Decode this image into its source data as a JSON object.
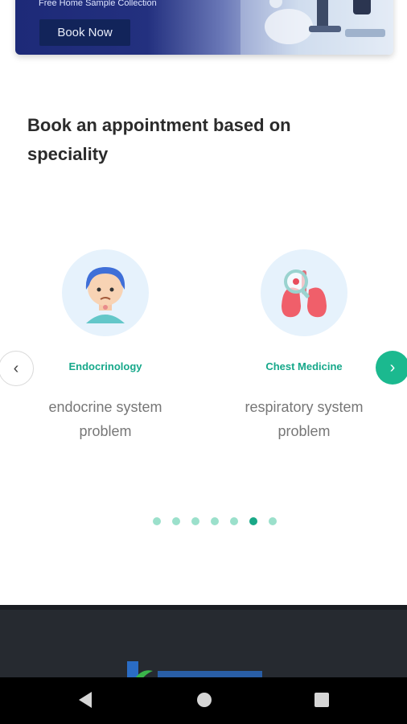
{
  "banner": {
    "subtitle": "Free Home Sample Collection",
    "button_label": "Book Now"
  },
  "section": {
    "heading": "Book an appointment based on speciality"
  },
  "specialities": [
    {
      "name": "Endocrinology",
      "description": "endocrine system problem",
      "icon": "endocrine-patient-icon"
    },
    {
      "name": "Chest Medicine",
      "description": "respiratory system problem",
      "icon": "lungs-icon"
    }
  ],
  "carousel": {
    "prev_icon": "chevron-left-icon",
    "next_icon": "chevron-right-icon",
    "dot_count": 7,
    "active_dot_index": 5
  },
  "colors": {
    "accent": "#1bb98f",
    "title_text": "#16a88a",
    "banner_dark": "#1d2a78"
  },
  "system_nav": {
    "back_icon": "back-triangle-icon",
    "home_icon": "home-circle-icon",
    "recents_icon": "recents-square-icon"
  }
}
